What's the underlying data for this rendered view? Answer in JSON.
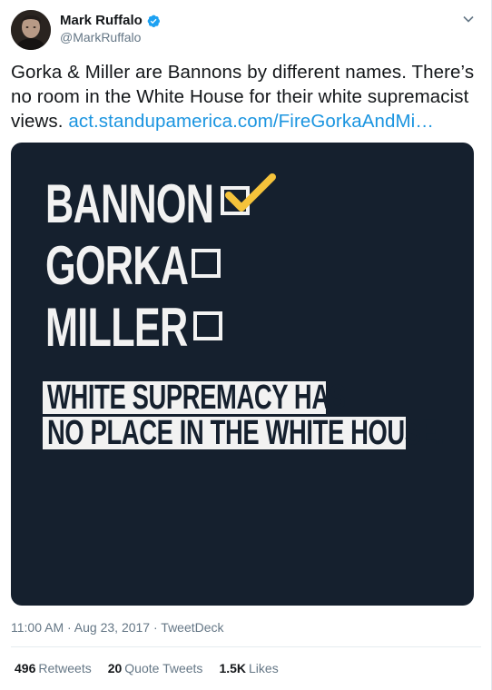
{
  "user": {
    "display_name": "Mark Ruffalo",
    "handle": "@MarkRuffalo",
    "verified": true,
    "avatar_icon": "profile-photo"
  },
  "tweet": {
    "text_before_link": "Gorka & Miller are Bannons by different names. There’s no room in the White House for their white supremacist views. ",
    "link_text": "act.standupamerica.com/FireGorkaAndMi…"
  },
  "image": {
    "lines": [
      "BANNON",
      "GORKA",
      "MILLER"
    ],
    "checked": [
      true,
      false,
      false
    ],
    "band_lines": [
      "WHITE SUPREMACY HAS",
      "NO PLACE IN THE WHITE HOUSE."
    ],
    "background_color": "#15202e",
    "text_color": "#f2f2f2",
    "check_color": "#f5c33b"
  },
  "meta": {
    "time": "11:00 AM",
    "date": "Aug 23, 2017",
    "source": "TweetDeck",
    "separator": " · "
  },
  "stats": {
    "retweets_count": "496",
    "retweets_label": "Retweets",
    "quote_count": "20",
    "quote_label": "Quote Tweets",
    "likes_count": "1.5K",
    "likes_label": "Likes"
  },
  "colors": {
    "link": "#1b95e0",
    "verified": "#1da1f2",
    "secondary_text": "#657786"
  },
  "icons": {
    "verified": "verified-badge-icon",
    "menu": "chevron-down-icon"
  }
}
